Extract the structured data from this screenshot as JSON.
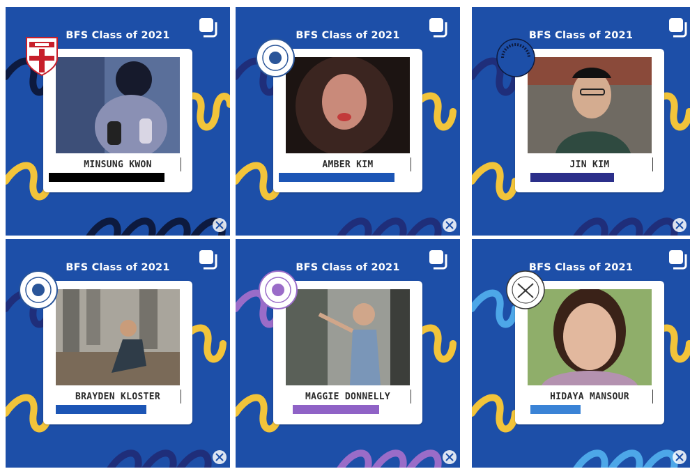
{
  "header_text": "BFS Class of 2021",
  "icons": {
    "copy": "copy-icon",
    "crest": "university-crest-icon",
    "seal": "university-seal-icon",
    "badge": "corner-badge-icon"
  },
  "colors": {
    "background_blue": "#1d4fa8",
    "loop_yellow": "#f2c43a",
    "loop_dark": "#0d1a3f",
    "loop_navy": "#1f2e7a",
    "loop_light_blue": "#4da7e8",
    "loop_purple": "#9a6cc8"
  },
  "students": [
    {
      "name": "MINSUNG KWON",
      "bar_color": "#000000"
    },
    {
      "name": "AMBER KIM",
      "bar_color": "#1c55b5"
    },
    {
      "name": "JIN KIM",
      "bar_color": "#2b2f8a"
    },
    {
      "name": "BRAYDEN KLOSTER",
      "bar_color": "#1c55b5"
    },
    {
      "name": "MAGGIE DONNELLY",
      "bar_color": "#8f62c6"
    },
    {
      "name": "HIDAYA MANSOUR",
      "bar_color": "#3a83d6"
    }
  ]
}
